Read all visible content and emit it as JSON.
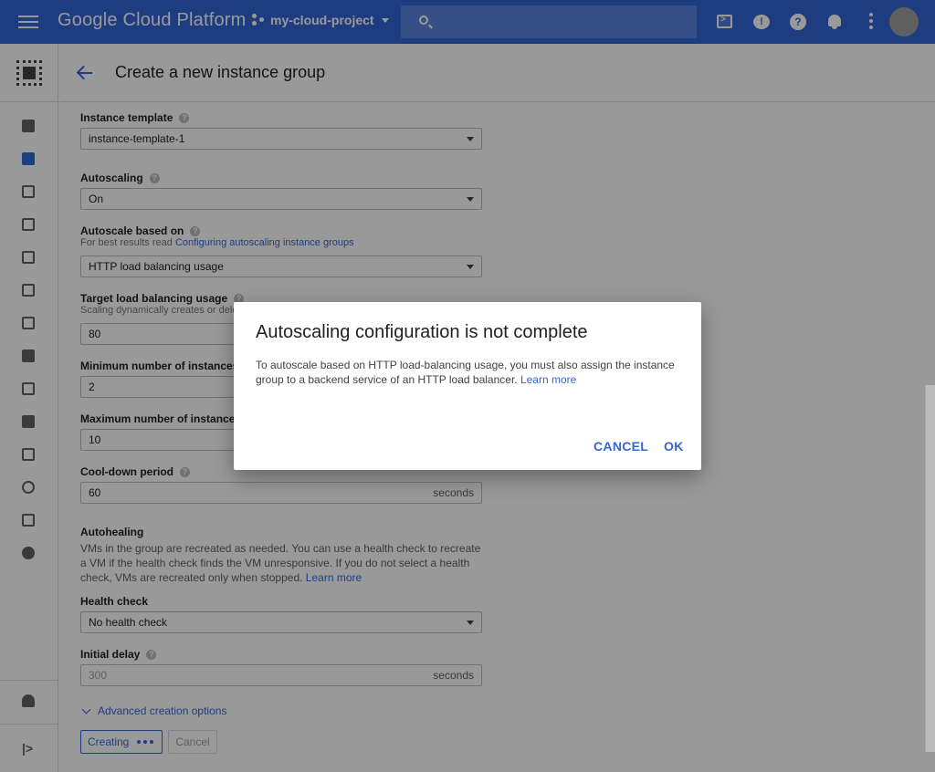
{
  "topbar": {
    "brand": "Google Cloud Platform",
    "project": "my-cloud-project"
  },
  "header": {
    "title": "Create a new instance group"
  },
  "form": {
    "instance_template": {
      "label": "Instance template",
      "value": "instance-template-1"
    },
    "autoscaling": {
      "label": "Autoscaling",
      "value": "On"
    },
    "autoscale_based_on": {
      "label": "Autoscale based on",
      "hint_prefix": "For best results read ",
      "hint_link": "Configuring autoscaling instance groups",
      "value": "HTTP load balancing usage"
    },
    "target_usage": {
      "label": "Target load balancing usage",
      "hint": "Scaling dynamically creates or dele",
      "value": "80"
    },
    "min_instances": {
      "label": "Minimum number of instances",
      "value": "2"
    },
    "max_instances": {
      "label": "Maximum number of instances",
      "value": "10"
    },
    "cooldown": {
      "label": "Cool-down period",
      "value": "60",
      "suffix": "seconds"
    },
    "autohealing": {
      "title": "Autohealing",
      "text": "VMs in the group are recreated as needed. You can use a health check to recreate a VM if the health check finds the VM unresponsive. If you do not select a health check, VMs are recreated only when stopped. ",
      "link": "Learn more"
    },
    "health_check": {
      "label": "Health check",
      "value": "No health check"
    },
    "initial_delay": {
      "label": "Initial delay",
      "placeholder": "300",
      "suffix": "seconds"
    },
    "advanced": "Advanced creation options",
    "creating_button": "Creating",
    "cancel_button": "Cancel"
  },
  "dialog": {
    "title": "Autoscaling configuration is not complete",
    "body": "To autoscale based on HTTP load-balancing usage, you must also assign the instance group to a backend service of an HTTP load balancer. ",
    "link": "Learn more",
    "cancel": "CANCEL",
    "ok": "OK"
  },
  "colors": {
    "brand_blue": "#3367d6",
    "overlay": "rgba(0,0,0,0.4)"
  },
  "icons": {
    "rail": [
      "compute-engine-icon",
      "vm-instances-icon",
      "instance-groups-icon",
      "instance-templates-icon",
      "sole-tenant-icon",
      "disks-icon",
      "snapshots-icon",
      "images-icon",
      "tpus-icon",
      "committed-use-icon",
      "metadata-icon",
      "health-checks-icon",
      "zones-icon",
      "operations-icon",
      "settings-icon",
      "marketplace-icon",
      "collapse-rail-icon"
    ]
  }
}
